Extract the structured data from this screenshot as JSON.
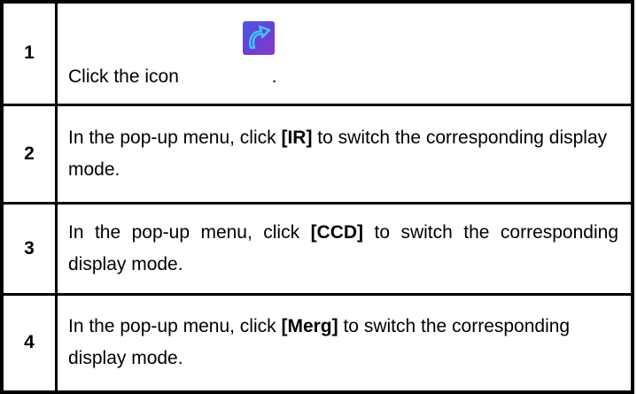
{
  "steps": [
    {
      "number": "1",
      "text": "Click the icon",
      "after_icon": ".",
      "icon": "curved-arrow-switch-icon"
    },
    {
      "number": "2",
      "before": "In the pop-up menu, click ",
      "bold": "[IR]",
      "after": " to switch the corresponding display mode."
    },
    {
      "number": "3",
      "before": "In the pop-up menu, click ",
      "bold": "[CCD]",
      "after": " to switch the corresponding display mode."
    },
    {
      "number": "4",
      "before": "In the pop-up menu, click ",
      "bold": "[Merg]",
      "after": " to switch the corresponding display mode."
    }
  ],
  "colors": {
    "icon_background": "#6b3fd1",
    "icon_arrow": "#3ec7ff"
  }
}
